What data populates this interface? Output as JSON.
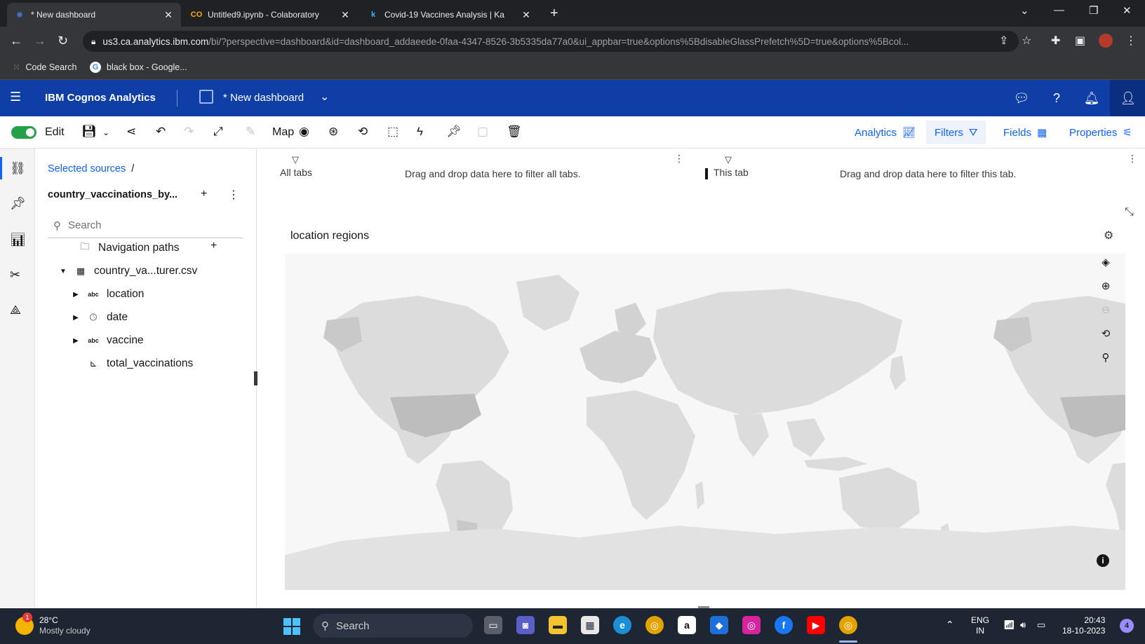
{
  "browser": {
    "tabs": [
      {
        "title": "* New dashboard",
        "active": true
      },
      {
        "title": "Untitled9.ipynb - Colaboratory",
        "active": false
      },
      {
        "title": "Covid-19 Vaccines Analysis | Ka",
        "active": false
      }
    ],
    "url_host": "us3.ca.analytics.ibm.com",
    "url_path": "/bi/?perspective=dashboard&id=dashboard_addaeede-0faa-4347-8526-3b5335da77a0&ui_appbar=true&options%5BdisableGlassPrefetch%5D=true&options%5Bcol...",
    "bookmarks": [
      "Code Search",
      "black box - Google..."
    ]
  },
  "app": {
    "brand": "IBM Cognos Analytics",
    "dashboard_title": "* New dashboard"
  },
  "toolbar": {
    "edit_label": "Edit",
    "map_label": "Map",
    "analytics_label": "Analytics",
    "filters_label": "Filters",
    "fields_label": "Fields",
    "properties_label": "Properties"
  },
  "sources": {
    "crumb": "Selected sources",
    "crumb_sep": "/",
    "source_name": "country_vaccinations_by...",
    "search_placeholder": "Search",
    "tree": [
      {
        "label": "Navigation paths",
        "type": "folder",
        "level": 1
      },
      {
        "label": "country_va...turer.csv",
        "type": "table",
        "level": 1,
        "expanded": true
      },
      {
        "label": "location",
        "type": "text",
        "level": 2
      },
      {
        "label": "date",
        "type": "date",
        "level": 2
      },
      {
        "label": "vaccine",
        "type": "text",
        "level": 2
      },
      {
        "label": "total_vaccinations",
        "type": "measure",
        "level": 2
      }
    ],
    "type_icons": {
      "text": "abc"
    }
  },
  "filters": {
    "all_tabs_label": "All tabs",
    "all_tabs_hint": "Drag and drop data here to filter all tabs.",
    "this_tab_label": "This tab",
    "this_tab_hint": "Drag and drop data here to filter this tab."
  },
  "visualization": {
    "title": "location regions",
    "map_base_color": "#dcdcdc",
    "map_highlight_color": "#bdbdbd"
  },
  "taskbar": {
    "temperature": "28°C",
    "condition": "Mostly cloudy",
    "weather_badge": "1",
    "search_label": "Search",
    "lang_top": "ENG",
    "lang_bottom": "IN",
    "time": "20:43",
    "date": "18-10-2023",
    "notifications": "4"
  }
}
